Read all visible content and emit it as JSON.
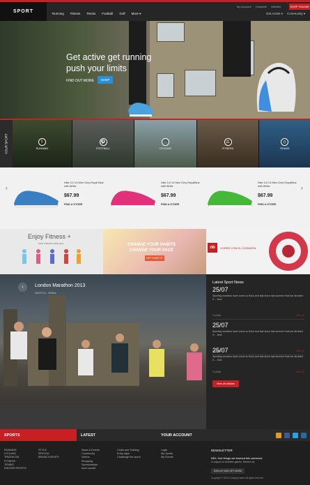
{
  "header": {
    "logo": "SPORT",
    "utility": [
      "My Account",
      "Compare",
      "Wishlist"
    ],
    "shop_online": "SHOP ONLINE",
    "nav": [
      "Running",
      "Fitness",
      "Tennis",
      "Football",
      "Golf",
      "More ▾"
    ],
    "right_nav": [
      "Get Active ▾",
      "Community ▾"
    ]
  },
  "hero": {
    "title_line1": "Get active get running",
    "title_line2": "push your limits",
    "find_out_more": "FIND OUT MORE",
    "shop": "SHOP"
  },
  "categories": {
    "tab": "YOUR SPORT",
    "items": [
      {
        "label": "RUNNING",
        "icon": "runner-icon"
      },
      {
        "label": "FOOTBALL",
        "icon": "football-icon"
      },
      {
        "label": "CYCLING",
        "icon": "bike-icon"
      },
      {
        "label": "FITNESS",
        "icon": "dumbbell-icon"
      },
      {
        "label": "TENNIS",
        "icon": "tennis-icon"
      }
    ]
  },
  "products": [
    {
      "name": "Nike 3.0 V4 Men Grey Royal Blue with White",
      "price": "$67.99",
      "find": "FIND A STORE",
      "color": "#3a7fc2"
    },
    {
      "name": "Nike 3.0 V4 Men Grey RoyalBlue with White",
      "price": "$67.99",
      "find": "FIND A STORE",
      "color": "#e0317a"
    },
    {
      "name": "Nike 3.0 V4 Men Grey RoyalBlue with White",
      "price": "$67.99",
      "find": "FIND A STORE",
      "color": "#45b83a"
    }
  ],
  "promos": {
    "fitness_title": "Enjoy Fitness +",
    "fitness_sub": "new classes near you",
    "habits_line1": "CHANGE YOUR HABITS",
    "habits_line2": "CHANGE YOUR PACE",
    "habits_btn": "GET YOUR FIT",
    "nb_brand": "nb",
    "nb_text": "CORRE CON EL CORAZÓN"
  },
  "marathon": {
    "title": "London Marathon 2013",
    "date": "24/07/13 - Online"
  },
  "news": {
    "title": "Latest Sport News",
    "items": [
      {
        "date": "25/07",
        "text": "Sporting wonders have come so thick and fast since last summer that we decided it ... time",
        "cat": "Football",
        "stats": "● 98    ● 5"
      },
      {
        "date": "25/07",
        "text": "Sporting wonders have come so thick and fast since last summer that we decided it ... time",
        "cat": "Football",
        "stats": "● 98    ● 5"
      },
      {
        "date": "25/07",
        "text": "Sporting wonders have come so thick and fast since last summer that we decided it ... time",
        "cat": "Football",
        "stats": "● 98    ● 5"
      }
    ],
    "all_button": "View all articles"
  },
  "footer": {
    "sports_title": "SPORTS",
    "sports_col1": [
      "RUNNING",
      "CYCLING",
      "TRIATHLON",
      "FITNESS",
      "TENNIS",
      "INDOOR SPORTS"
    ],
    "sports_col2": [
      "STYLE",
      "SPECIAL",
      "BRAND EVENTS"
    ],
    "latest_title": "LATEST",
    "latest_col1": [
      "News & Events",
      "Community",
      "Videos",
      "Shopping",
      "Sponsorships",
      "more sports"
    ],
    "latest_col2": [
      "Clubs and Training",
      "Entry days",
      "Challenge the world"
    ],
    "account_title": "YOUR ACCOUNT",
    "account_items": [
      "Login",
      "My Sports",
      "My Events"
    ],
    "newsletter_title": "NEWSLETTER",
    "newsletter_text": "NRL: five things we learned this weekend",
    "newsletter_sub": "In support of activities games. Mention by",
    "newsletter_btn": "SIGN UP AND GET MORE",
    "copyright": "Copyright © 2013 Company Name All rights reserved"
  }
}
